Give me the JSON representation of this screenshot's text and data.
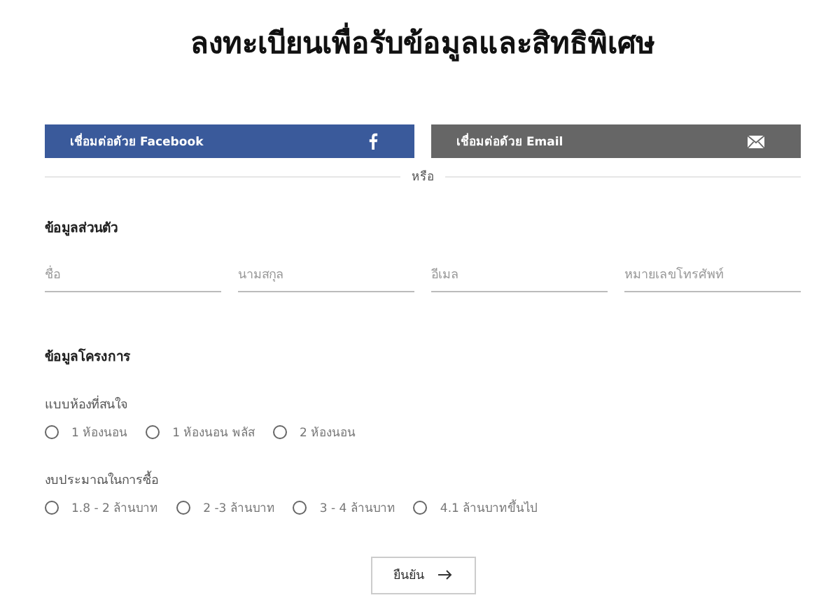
{
  "title": "ลงทะเบียนเพื่อรับข้อมูลและสิทธิพิเศษ",
  "social_buttons": [
    {
      "kind": "facebook",
      "label": "เชื่อมต่อด้วย Facebook"
    },
    {
      "kind": "email",
      "label": "เชื่อมต่อด้วย Email"
    }
  ],
  "divider": "หรือ",
  "personal": {
    "heading": "ข้อมูลส่วนตัว",
    "fields": [
      {
        "placeholder": "ชื่อ"
      },
      {
        "placeholder": "นามสกุล"
      },
      {
        "placeholder": "อีเมล"
      },
      {
        "placeholder": "หมายเลขโทรศัพท์"
      }
    ]
  },
  "project": {
    "heading": "ข้อมูลโครงการ",
    "groups": [
      {
        "label": "แบบห้องที่สนใจ",
        "options": [
          {
            "label": "1 ห้องนอน",
            "selected": false
          },
          {
            "label": "1 ห้องนอน พลัส",
            "selected": false
          },
          {
            "label": "2 ห้องนอน",
            "selected": false
          }
        ]
      },
      {
        "label": "งบประมาณในการซื้อ",
        "options": [
          {
            "label": "1.8 - 2 ล้านบาท",
            "selected": false
          },
          {
            "label": "2 -3 ล้านบาท",
            "selected": false
          },
          {
            "label": "3 - 4 ล้านบาท",
            "selected": false
          },
          {
            "label": "4.1 ล้านบาทขึ้นไป",
            "selected": false
          }
        ]
      }
    ]
  },
  "submit": "ยืนยัน"
}
